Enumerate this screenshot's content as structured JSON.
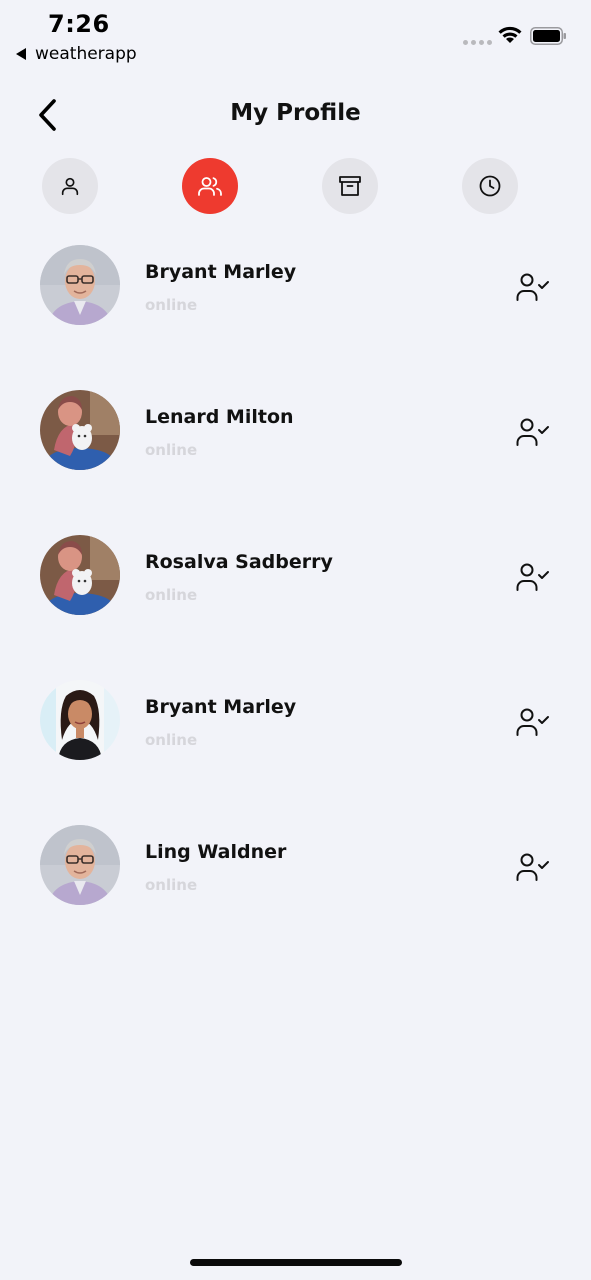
{
  "status_bar": {
    "time": "7:26",
    "back_app": "weatherapp"
  },
  "header": {
    "title": "My Profile",
    "back_icon": "chevron-left-icon"
  },
  "tabs": [
    {
      "icon": "user-icon",
      "active": false
    },
    {
      "icon": "users-icon",
      "active": true
    },
    {
      "icon": "archive-icon",
      "active": false
    },
    {
      "icon": "clock-icon",
      "active": false
    }
  ],
  "friends": [
    {
      "name": "Bryant Marley",
      "status": "online",
      "avatar": "man-grey-hair-glasses"
    },
    {
      "name": "Lenard Milton",
      "status": "online",
      "avatar": "woman-holding-toy"
    },
    {
      "name": "Rosalva Sadberry",
      "status": "online",
      "avatar": "woman-holding-toy"
    },
    {
      "name": "Bryant Marley",
      "status": "online",
      "avatar": "woman-dark-hair"
    },
    {
      "name": "Ling Waldner",
      "status": "online",
      "avatar": "man-grey-hair-glasses"
    }
  ],
  "colors": {
    "background": "#f2f3f9",
    "accent": "#ee3a2f",
    "tab_inactive": "#e4e4e9",
    "status_text": "#d6d6db"
  }
}
